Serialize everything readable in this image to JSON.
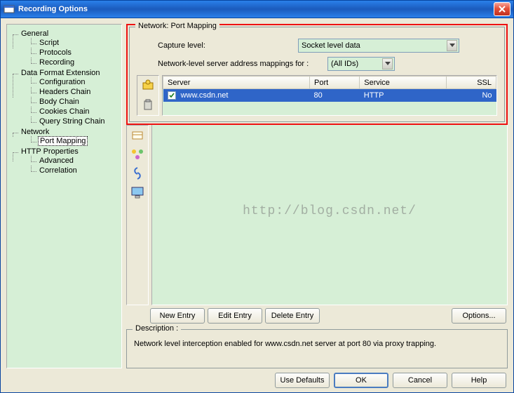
{
  "window": {
    "title": "Recording Options"
  },
  "tree": {
    "general": {
      "label": "General",
      "items": [
        "Script",
        "Protocols",
        "Recording"
      ]
    },
    "dfe": {
      "label": "Data Format Extension",
      "items": [
        "Configuration",
        "Headers Chain",
        "Body Chain",
        "Cookies Chain",
        "Query String Chain"
      ]
    },
    "network": {
      "label": "Network",
      "items": [
        "Port Mapping"
      ]
    },
    "http": {
      "label": "HTTP Properties",
      "items": [
        "Advanced",
        "Correlation"
      ]
    }
  },
  "panel": {
    "group_title": "Network: Port Mapping",
    "capture_label": "Capture level:",
    "capture_value": "Socket level data",
    "mapping_label": "Network-level server address mappings for :",
    "mapping_value": "(All IDs)"
  },
  "table": {
    "headers": {
      "server": "Server",
      "port": "Port",
      "service": "Service",
      "ssl": "SSL"
    },
    "row0": {
      "checked": true,
      "server": "www.csdn.net",
      "port": "80",
      "service": "HTTP",
      "ssl": "No"
    }
  },
  "watermark": "http://blog.csdn.net/",
  "buttons": {
    "new_entry": "New Entry",
    "edit_entry": "Edit Entry",
    "delete_entry": "Delete Entry",
    "options": "Options...",
    "use_defaults": "Use Defaults",
    "ok": "OK",
    "cancel": "Cancel",
    "help": "Help"
  },
  "description": {
    "title": "Description :",
    "text": "Network level interception enabled for www.csdn.net server at port 80 via proxy trapping."
  }
}
